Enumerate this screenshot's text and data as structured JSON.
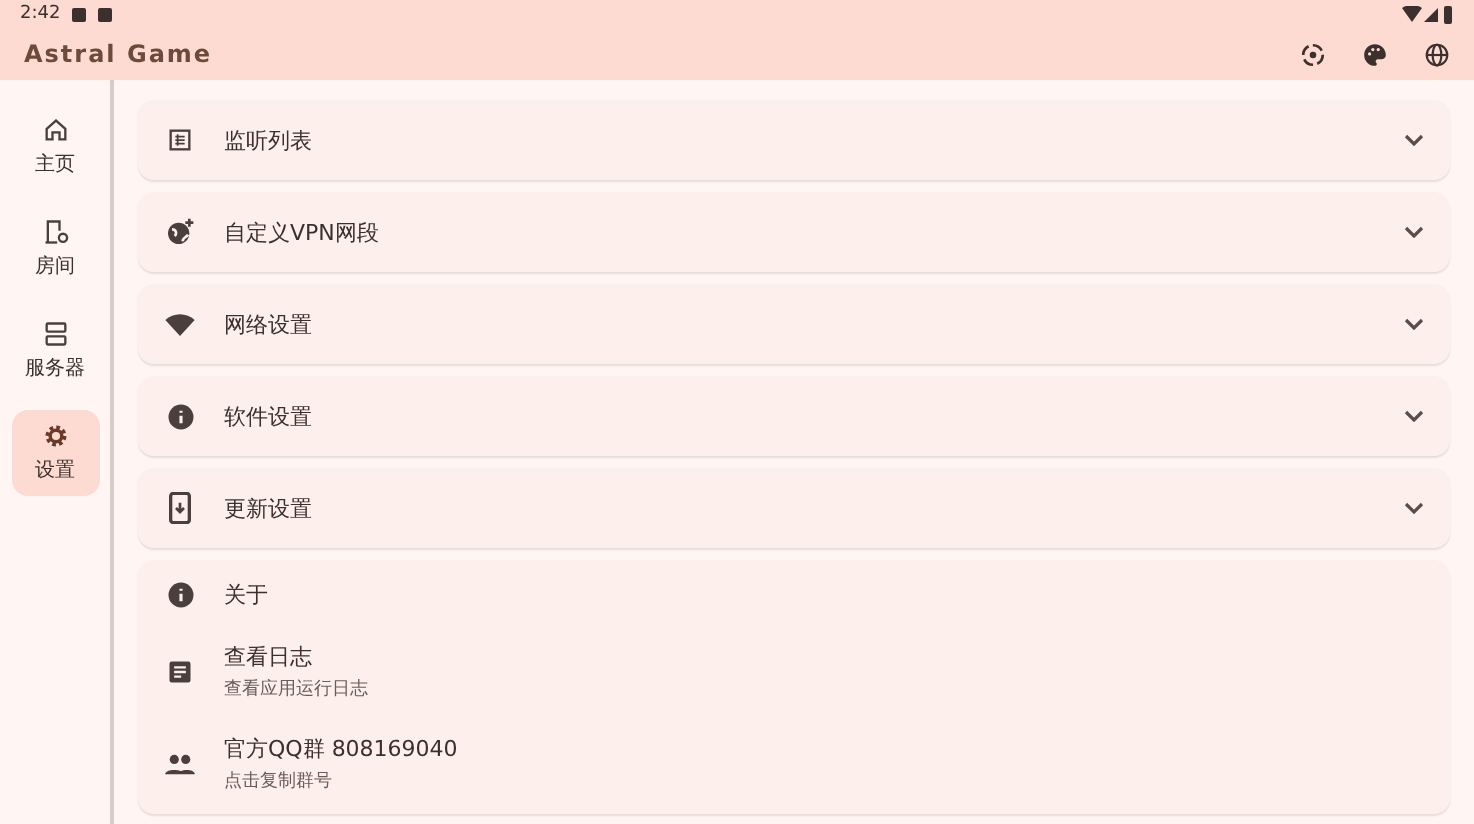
{
  "status_bar": {
    "time": "2:42"
  },
  "app_bar": {
    "title": "Astral Game"
  },
  "nav": [
    {
      "label": "主页",
      "kind": "home",
      "selected": false
    },
    {
      "label": "房间",
      "kind": "room",
      "selected": false
    },
    {
      "label": "服务器",
      "kind": "server",
      "selected": false
    },
    {
      "label": "设置",
      "kind": "settings",
      "selected": true
    }
  ],
  "sections": [
    {
      "title": "监听列表",
      "kind": "list",
      "expanded": false
    },
    {
      "title": "自定义VPN网段",
      "kind": "globe",
      "expanded": false
    },
    {
      "title": "网络设置",
      "kind": "wifi",
      "expanded": false
    },
    {
      "title": "软件设置",
      "kind": "info",
      "expanded": false
    },
    {
      "title": "更新设置",
      "kind": "phone",
      "expanded": false
    }
  ],
  "about": {
    "title": "关于",
    "items": [
      {
        "title": "查看日志",
        "subtitle": "查看应用运行日志",
        "kind": "log"
      },
      {
        "title": "官方QQ群 808169040",
        "subtitle": "点击复制群号",
        "kind": "people"
      }
    ]
  }
}
